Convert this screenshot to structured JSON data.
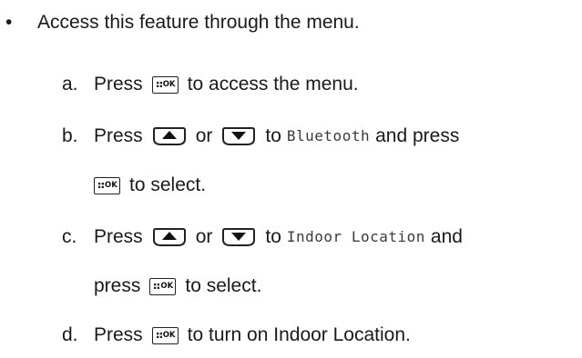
{
  "instructions": {
    "bullet": "•",
    "intro": "Access this feature through the menu.",
    "steps": [
      {
        "letter": "a.",
        "press": "Press",
        "tail": "to access the menu."
      },
      {
        "letter": "b.",
        "press": "Press",
        "or": "or",
        "to": "to",
        "menu_item": "Bluetooth",
        "and_press": "and press",
        "tail": "to select."
      },
      {
        "letter": "c.",
        "press": "Press",
        "or": "or",
        "to": "to",
        "menu_item": "Indoor Location",
        "and": "and",
        "press2": "press",
        "tail": "to select."
      },
      {
        "letter": "d.",
        "press": "Press",
        "tail": "to turn on Indoor Location."
      }
    ]
  },
  "icons": {
    "menu_ok_key": "menu-ok-key-icon",
    "up_key": "up-arrow-key-icon",
    "down_key": "down-arrow-key-icon"
  },
  "key_label": "OK"
}
